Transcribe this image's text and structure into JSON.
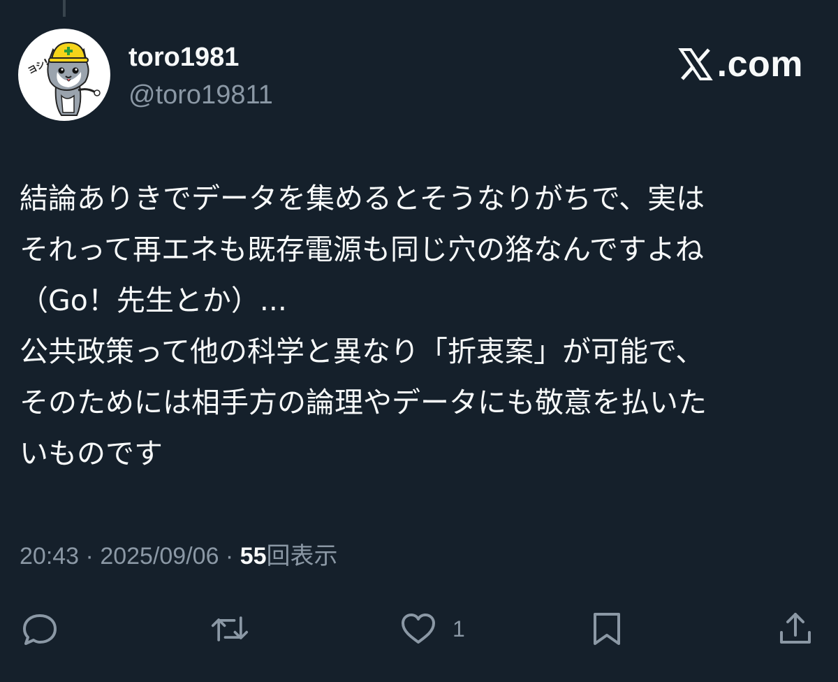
{
  "author": {
    "display_name": "toro1981",
    "handle": "@toro19811",
    "avatar_icon": "hardhat-cat-avatar-icon",
    "avatar_text": "ヨシ!"
  },
  "brand": {
    "icon": "x-logo-icon",
    "text": ".com"
  },
  "tweet": {
    "lines": [
      "結論ありきでデータを集めるとそうなりがちで、実は",
      "それって再エネも既存電源も同じ穴の狢なんですよね",
      "（Go！先生とか）...",
      "公共政策って他の科学と異なり「折衷案」が可能で、",
      "そのためには相手方の論理やデータにも敬意を払いた",
      "いものです"
    ]
  },
  "meta": {
    "time": "20:43",
    "separator": " · ",
    "date": "2025/09/06",
    "views_count": "55",
    "views_label": "回表示"
  },
  "actions": {
    "reply_icon": "reply-icon",
    "repost_icon": "repost-icon",
    "like_icon": "heart-icon",
    "like_count": "1",
    "bookmark_icon": "bookmark-icon",
    "share_icon": "share-icon"
  },
  "colors": {
    "background": "#15202b",
    "primary_text": "#f7f9f9",
    "secondary_text": "#8b98a5"
  }
}
